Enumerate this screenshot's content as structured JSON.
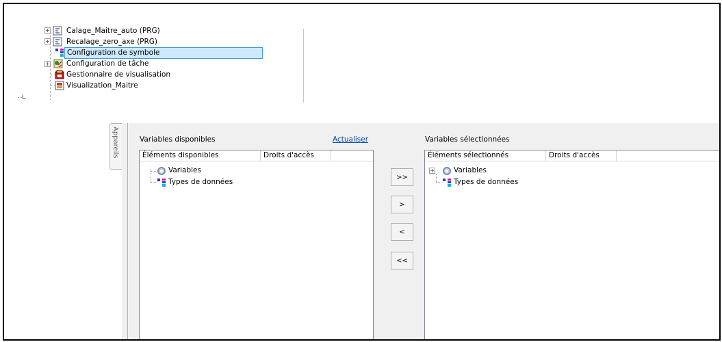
{
  "project_tree": {
    "items": [
      {
        "label": "Calage_Maitre_auto (PRG)",
        "icon": "program-icon",
        "expandable": true
      },
      {
        "label": "Recalage_zero_axe (PRG)",
        "icon": "program-icon",
        "expandable": true
      },
      {
        "label": "Configuration de symbole",
        "icon": "symbol-config-icon",
        "expandable": false,
        "selected": true
      },
      {
        "label": "Configuration de tâche",
        "icon": "task-config-icon",
        "expandable": true
      },
      {
        "label": "Gestionnaire de visualisation",
        "icon": "visualization-manager-icon",
        "expandable": false
      },
      {
        "label": "Visualization_Maitre",
        "icon": "visualization-icon",
        "expandable": false
      }
    ]
  },
  "side_tab": {
    "label": "Appareils"
  },
  "available": {
    "title": "Variables disponibles",
    "refresh_label": "Actualiser",
    "col_elements": "Éléments disponibles",
    "col_access": "Droits d'accès",
    "items": [
      {
        "label": "Variables",
        "icon": "variables-gear-icon"
      },
      {
        "label": "Types de données",
        "icon": "data-types-icon"
      }
    ]
  },
  "transfer_buttons": {
    "add_all": ">>",
    "add": ">",
    "remove": "<",
    "remove_all": "<<"
  },
  "selected": {
    "title": "Variables sélectionnées",
    "col_elements": "Éléments sélectionnés",
    "col_access": "Droits d'accès",
    "items": [
      {
        "label": "Variables",
        "icon": "variables-gear-icon"
      },
      {
        "label": "Types de données",
        "icon": "data-types-icon"
      }
    ]
  },
  "colors": {
    "selection_bg": "#cde8ff",
    "selection_border": "#3f9bd8",
    "link": "#0645ad",
    "panel_bg": "#f0f0f0"
  }
}
